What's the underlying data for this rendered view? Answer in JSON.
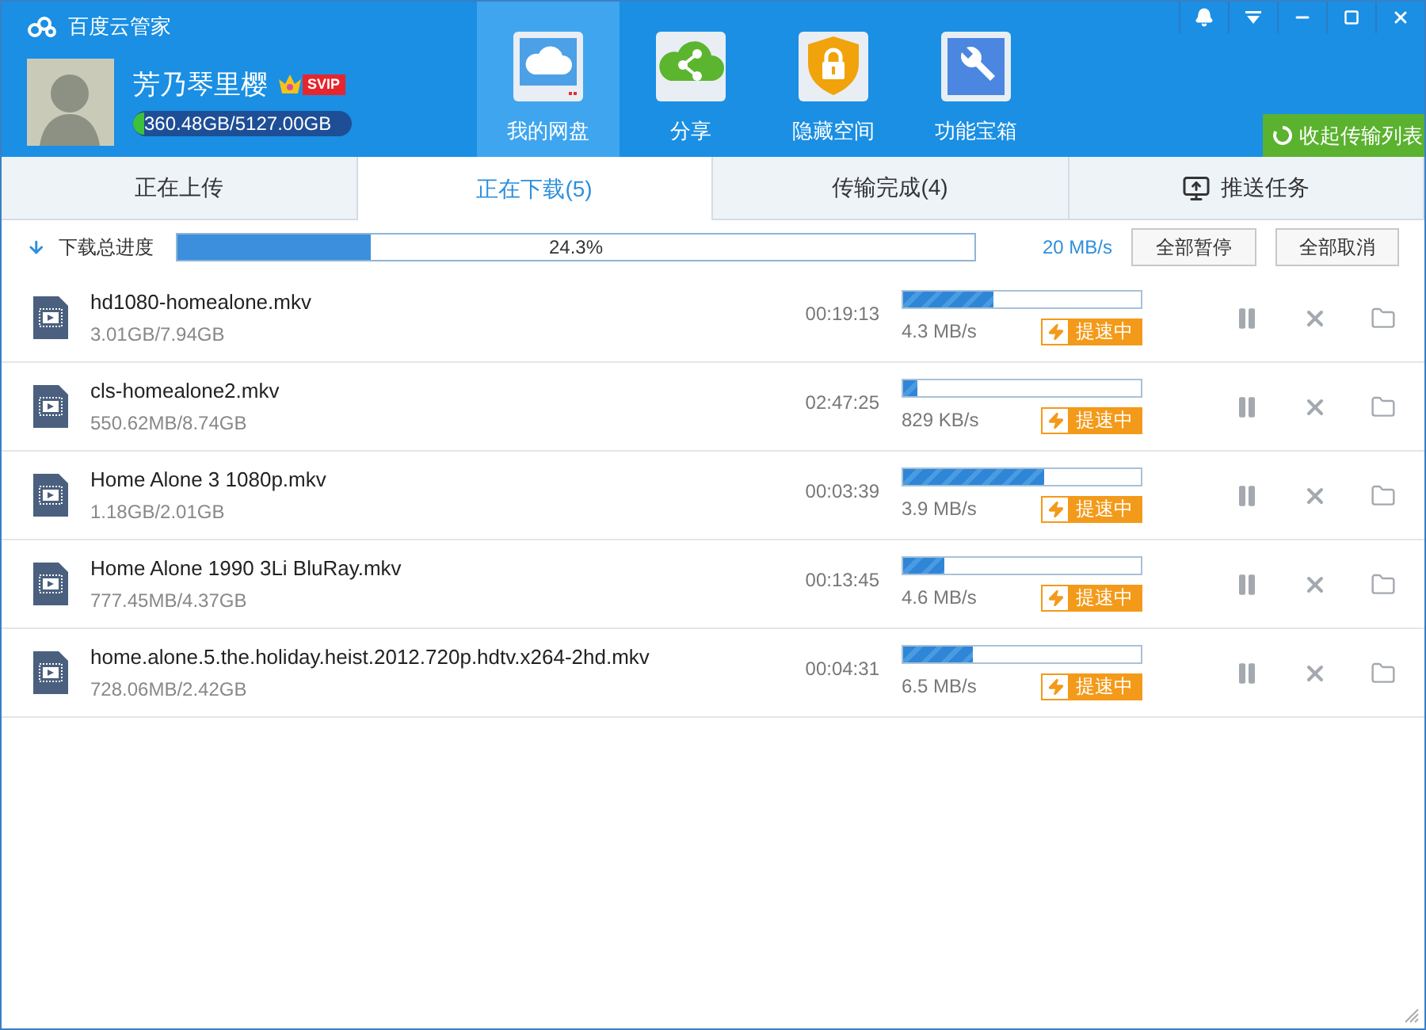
{
  "window": {
    "title": "百度云管家"
  },
  "user": {
    "name": "芳乃琴里樱",
    "badge": "SVIP",
    "quota": "360.48GB/5127.00GB"
  },
  "nav": [
    {
      "label": "我的网盘",
      "kind": "disk",
      "selected": true
    },
    {
      "label": "分享",
      "kind": "share",
      "selected": false
    },
    {
      "label": "隐藏空间",
      "kind": "lock",
      "selected": false
    },
    {
      "label": "功能宝箱",
      "kind": "tools",
      "selected": false
    }
  ],
  "collapse_button": "收起传输列表",
  "tabs": [
    {
      "label": "正在上传",
      "selected": false
    },
    {
      "label": "正在下载(5)",
      "selected": true
    },
    {
      "label": "传输完成(4)",
      "selected": false
    },
    {
      "label": "推送任务",
      "selected": false
    }
  ],
  "total": {
    "label": "下载总进度",
    "level": 0.243,
    "percent": "24.3%",
    "speed": "20 MB/s",
    "buttons": [
      "全部暂停",
      "全部取消"
    ]
  },
  "downloads": [
    {
      "name": "hd1080-homealone.mkv",
      "size": "3.01GB/7.94GB",
      "remaining": "00:19:13",
      "level": 0.38,
      "speed": "4.3 MB/s",
      "boost": "提速中"
    },
    {
      "name": "cls-homealone2.mkv",
      "size": "550.62MB/8.74GB",
      "remaining": "02:47:25",
      "level": 0.06,
      "speed": "829 KB/s",
      "boost": "提速中"
    },
    {
      "name": "Home Alone 3 1080p.mkv",
      "size": "1.18GB/2.01GB",
      "remaining": "00:03:39",
      "level": 0.59,
      "speed": "3.9 MB/s",
      "boost": "提速中"
    },
    {
      "name": "Home Alone 1990 3Li BluRay.mkv",
      "size": "777.45MB/4.37GB",
      "remaining": "00:13:45",
      "level": 0.17,
      "speed": "4.6 MB/s",
      "boost": "提速中"
    },
    {
      "name": "home.alone.5.the.holiday.heist.2012.720p.hdtv.x264-2hd.mkv",
      "size": "728.06MB/2.42GB",
      "remaining": "00:04:31",
      "level": 0.29,
      "speed": "6.5 MB/s",
      "boost": "提速中"
    }
  ]
}
